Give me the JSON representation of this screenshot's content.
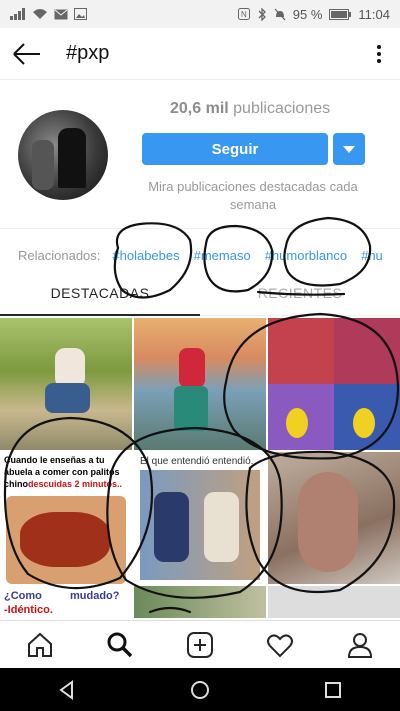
{
  "status": {
    "signal_icon": "signal-icon",
    "battery": "95 %",
    "time": "11:04"
  },
  "header": {
    "title": "#pxp"
  },
  "profile": {
    "count_value": "20,6 mil",
    "count_label": "publicaciones",
    "follow_label": "Seguir",
    "hint": "Mira publicaciones destacadas cada semana"
  },
  "related": {
    "label": "Relacionados:",
    "tags": [
      "#holabebes",
      "#memaso",
      "#humorblanco",
      "#hu"
    ]
  },
  "tabs": {
    "top": "DESTACADAS",
    "recent": "RECIENTES"
  },
  "grid": {
    "meme1_caption": "Cuando le enseñas a tu abuela a comer con palitos chinos",
    "meme1_time": "descuidas 2 minutos..",
    "meme2_caption": "El que entendió entendió.",
    "meme3_caption": "¿Como",
    "meme3_q": "mudado?",
    "meme3_answer": "-Idéntico."
  },
  "colors": {
    "accent": "#3897f0"
  }
}
